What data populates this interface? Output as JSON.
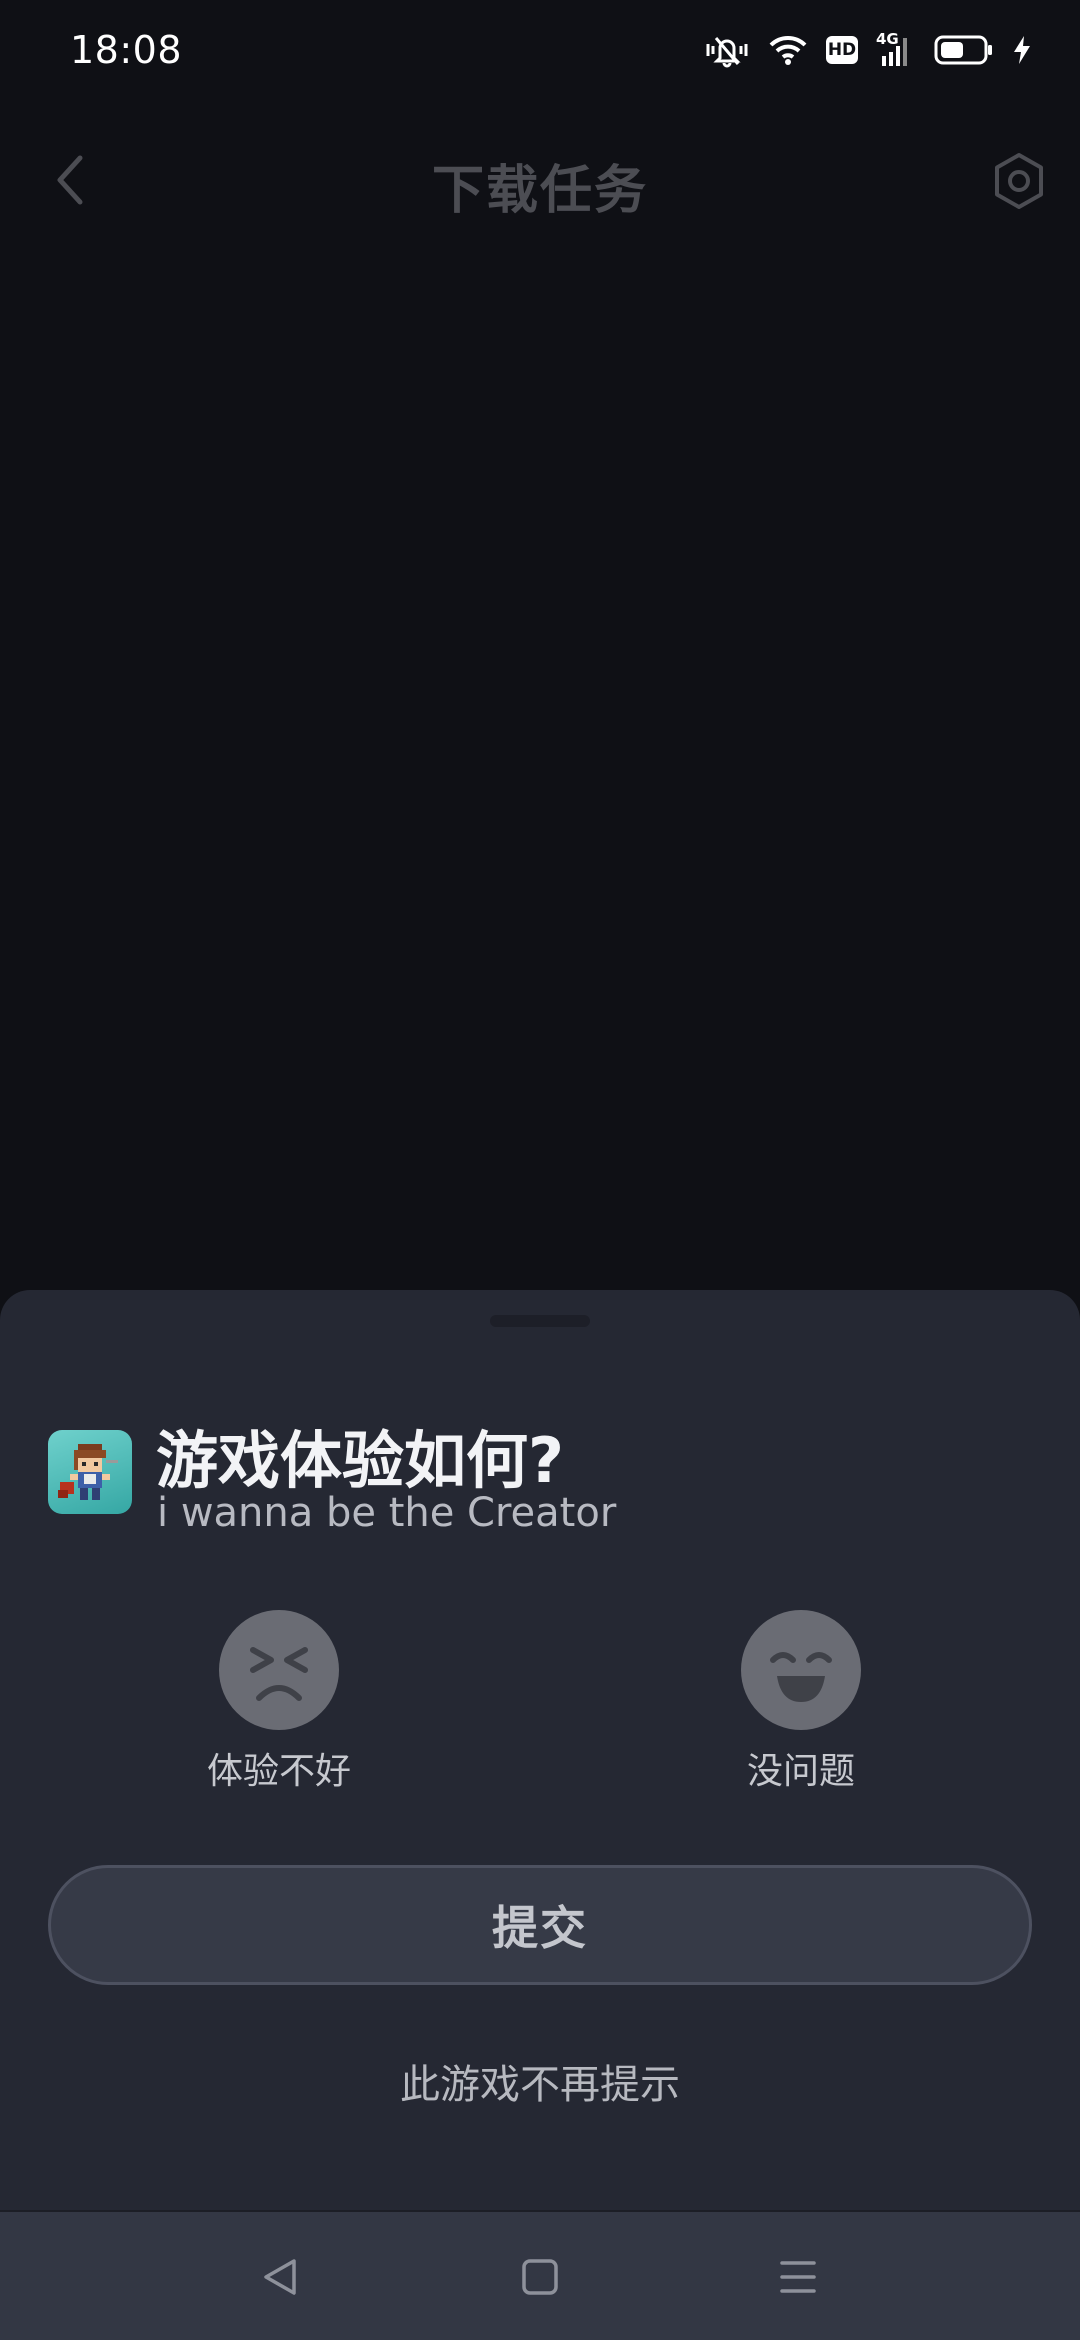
{
  "status_bar": {
    "time": "18:08",
    "hd_label": "HD",
    "network_label": "4G",
    "icons": [
      "vibrate-mute-icon",
      "wifi-icon",
      "hd-icon",
      "signal-4g-icon",
      "battery-icon",
      "charging-bolt-icon"
    ]
  },
  "app_bar": {
    "title": "下载任务",
    "back_icon": "chevron-left-icon",
    "settings_icon": "gear-icon"
  },
  "sheet": {
    "title": "游戏体验如何?",
    "game_name": "i wanna be the Creator",
    "ratings": [
      {
        "label": "体验不好",
        "icon": "sad-face-icon"
      },
      {
        "label": "没问题",
        "icon": "happy-face-icon"
      }
    ],
    "submit_label": "提交",
    "dismiss_label": "此游戏不再提示"
  },
  "nav_bar": {
    "icons": [
      "nav-back-icon",
      "nav-home-icon",
      "nav-menu-icon"
    ]
  },
  "colors": {
    "background": "#0f1015",
    "sheet": "#252833",
    "button": "#363a47",
    "nav": "#333744",
    "face": "#6a6c74"
  }
}
